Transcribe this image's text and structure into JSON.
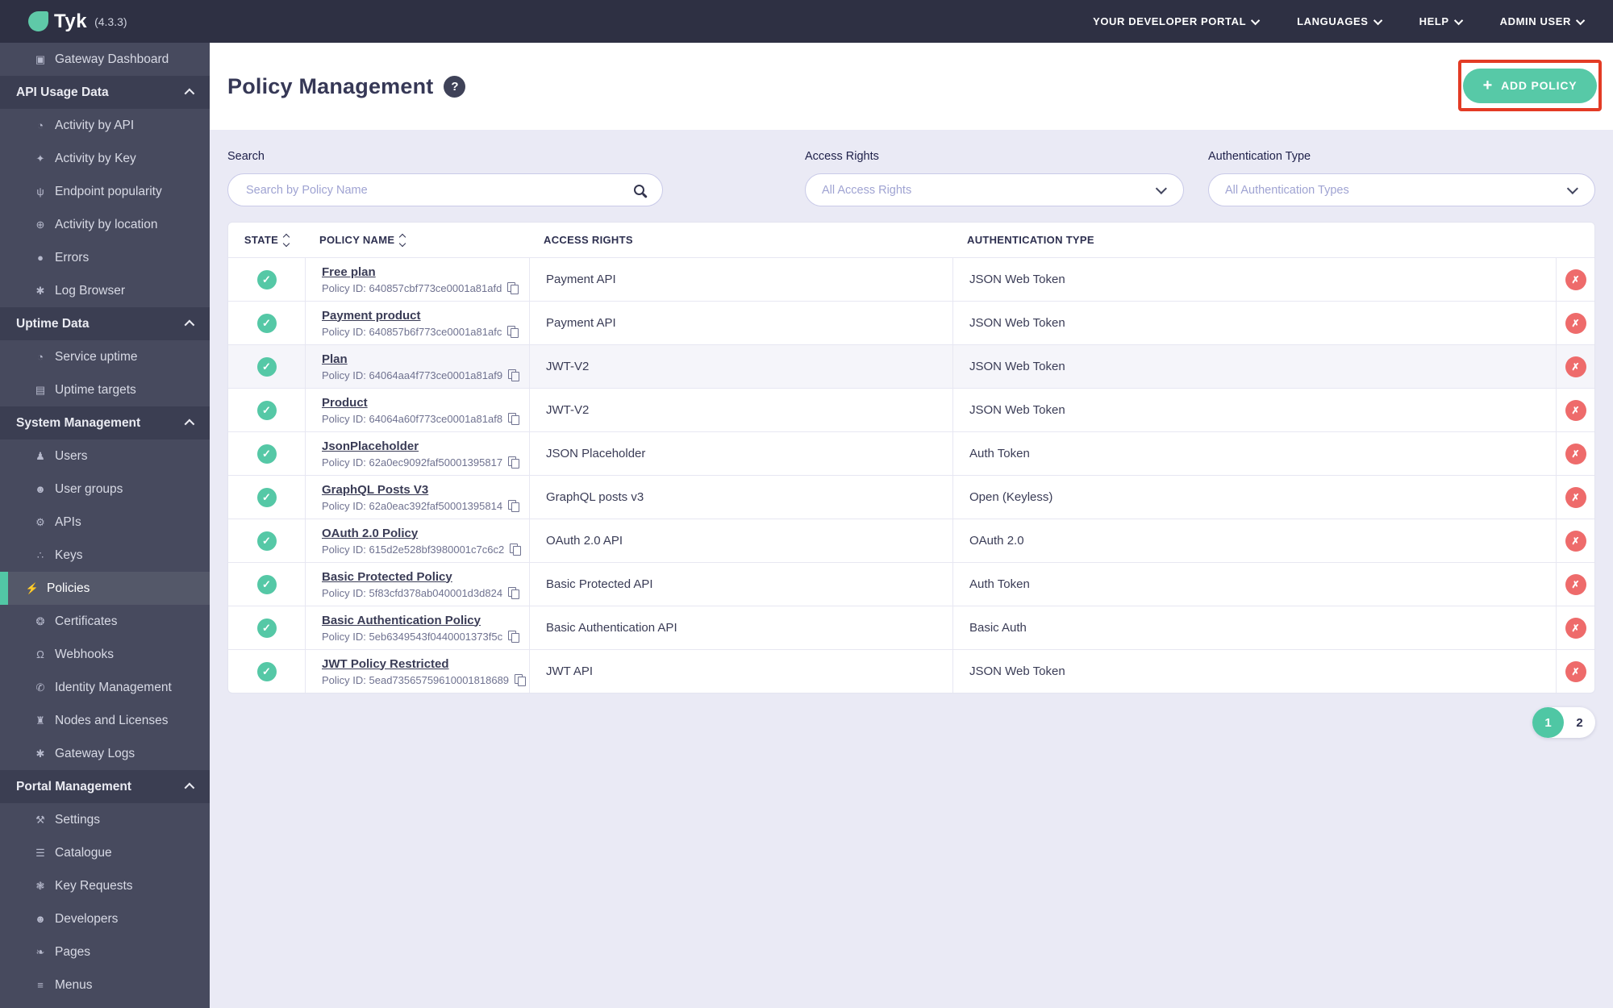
{
  "colors": {
    "topbar_bg": "#2e3043",
    "sidebar_bg": "#474a5e",
    "section_bg": "#3b3e52",
    "accent_teal": "#52c7a5",
    "page_bg": "#eaeaf5",
    "delete_red": "#ee6b6b",
    "annotation_red": "#e33b25"
  },
  "icons": {
    "monitor-icon": "▣",
    "chart-icon": "◔",
    "key-icon": "✦",
    "fork-icon": "ψ",
    "globe-icon": "⊕",
    "bomb-icon": "●",
    "bug-icon": "✱",
    "list-icon": "▤",
    "user-icon": "♟",
    "users-icon": "☻",
    "gears-icon": "⚙",
    "sitemap-icon": "∴",
    "bolt-icon": "⚡",
    "certificate-icon": "❂",
    "bell-icon": "Ω",
    "phone-icon": "✆",
    "bank-icon": "♜",
    "wrench-icon": "⚒",
    "catalogue-icon": "☰",
    "paw-icon": "❃",
    "leaf-icon": "❧",
    "bars-icon": "≡",
    "check-icon": "✓",
    "delete-icon": "✗",
    "plus-icon": "+",
    "help-icon": "?"
  },
  "topbar": {
    "logo_text": "Tyk",
    "version": "(4.3.3)",
    "menu": [
      "YOUR DEVELOPER PORTAL",
      "LANGUAGES",
      "HELP",
      "ADMIN USER"
    ]
  },
  "sidebar": {
    "items": [
      {
        "type": "link",
        "label": "Gateway Dashboard",
        "icon": "monitor-icon"
      },
      {
        "type": "section",
        "label": "API Usage Data"
      },
      {
        "type": "link",
        "label": "Activity by API",
        "icon": "chart-icon"
      },
      {
        "type": "link",
        "label": "Activity by Key",
        "icon": "key-icon"
      },
      {
        "type": "link",
        "label": "Endpoint popularity",
        "icon": "fork-icon"
      },
      {
        "type": "link",
        "label": "Activity by location",
        "icon": "globe-icon"
      },
      {
        "type": "link",
        "label": "Errors",
        "icon": "bomb-icon"
      },
      {
        "type": "link",
        "label": "Log Browser",
        "icon": "bug-icon"
      },
      {
        "type": "section",
        "label": "Uptime Data"
      },
      {
        "type": "link",
        "label": "Service uptime",
        "icon": "chart-icon"
      },
      {
        "type": "link",
        "label": "Uptime targets",
        "icon": "list-icon"
      },
      {
        "type": "section",
        "label": "System Management"
      },
      {
        "type": "link",
        "label": "Users",
        "icon": "user-icon"
      },
      {
        "type": "link",
        "label": "User groups",
        "icon": "users-icon"
      },
      {
        "type": "link",
        "label": "APIs",
        "icon": "gears-icon"
      },
      {
        "type": "link",
        "label": "Keys",
        "icon": "sitemap-icon"
      },
      {
        "type": "link",
        "label": "Policies",
        "icon": "bolt-icon",
        "active": true
      },
      {
        "type": "link",
        "label": "Certificates",
        "icon": "certificate-icon"
      },
      {
        "type": "link",
        "label": "Webhooks",
        "icon": "bell-icon"
      },
      {
        "type": "link",
        "label": "Identity Management",
        "icon": "phone-icon"
      },
      {
        "type": "link",
        "label": "Nodes and Licenses",
        "icon": "bank-icon"
      },
      {
        "type": "link",
        "label": "Gateway Logs",
        "icon": "bug-icon"
      },
      {
        "type": "section",
        "label": "Portal Management"
      },
      {
        "type": "link",
        "label": "Settings",
        "icon": "wrench-icon"
      },
      {
        "type": "link",
        "label": "Catalogue",
        "icon": "catalogue-icon"
      },
      {
        "type": "link",
        "label": "Key Requests",
        "icon": "paw-icon"
      },
      {
        "type": "link",
        "label": "Developers",
        "icon": "users-icon"
      },
      {
        "type": "link",
        "label": "Pages",
        "icon": "leaf-icon"
      },
      {
        "type": "link",
        "label": "Menus",
        "icon": "bars-icon"
      }
    ]
  },
  "header": {
    "title": "Policy Management",
    "help_label": "?",
    "add_policy_label": "ADD POLICY"
  },
  "filters": {
    "search_label": "Search",
    "search_placeholder": "Search by Policy Name",
    "access_label": "Access Rights",
    "access_value": "All Access Rights",
    "auth_label": "Authentication Type",
    "auth_value": "All Authentication Types"
  },
  "table": {
    "columns": [
      {
        "label": "STATE",
        "sortable": true
      },
      {
        "label": "POLICY NAME",
        "sortable": true
      },
      {
        "label": "ACCESS RIGHTS",
        "sortable": false
      },
      {
        "label": "AUTHENTICATION TYPE",
        "sortable": false
      }
    ],
    "policy_id_prefix": "Policy ID: ",
    "rows": [
      {
        "name": "Free plan",
        "policy_id": "640857cbf773ce0001a81afd",
        "access": "Payment API",
        "auth": "JSON Web Token"
      },
      {
        "name": "Payment product",
        "policy_id": "640857b6f773ce0001a81afc",
        "access": "Payment API",
        "auth": "JSON Web Token"
      },
      {
        "name": "Plan",
        "policy_id": "64064aa4f773ce0001a81af9",
        "access": "JWT-V2",
        "auth": "JSON Web Token",
        "highlighted": true
      },
      {
        "name": "Product",
        "policy_id": "64064a60f773ce0001a81af8",
        "access": "JWT-V2",
        "auth": "JSON Web Token"
      },
      {
        "name": "JsonPlaceholder",
        "policy_id": "62a0ec9092faf50001395817",
        "access": "JSON Placeholder",
        "auth": "Auth Token"
      },
      {
        "name": "GraphQL Posts V3",
        "policy_id": "62a0eac392faf50001395814",
        "access": "GraphQL posts v3",
        "auth": "Open (Keyless)"
      },
      {
        "name": "OAuth 2.0 Policy",
        "policy_id": "615d2e528bf3980001c7c6c2",
        "access": "OAuth 2.0 API",
        "auth": "OAuth 2.0"
      },
      {
        "name": "Basic Protected Policy",
        "policy_id": "5f83cfd378ab040001d3d824",
        "access": "Basic Protected API",
        "auth": "Auth Token"
      },
      {
        "name": "Basic Authentication Policy",
        "policy_id": "5eb6349543f0440001373f5c",
        "access": "Basic Authentication API",
        "auth": "Basic Auth"
      },
      {
        "name": "JWT Policy Restricted",
        "policy_id": "5ead73565759610001818689",
        "access": "JWT API",
        "auth": "JSON Web Token"
      }
    ]
  },
  "pagination": {
    "pages": [
      "1",
      "2"
    ],
    "active": "1"
  }
}
